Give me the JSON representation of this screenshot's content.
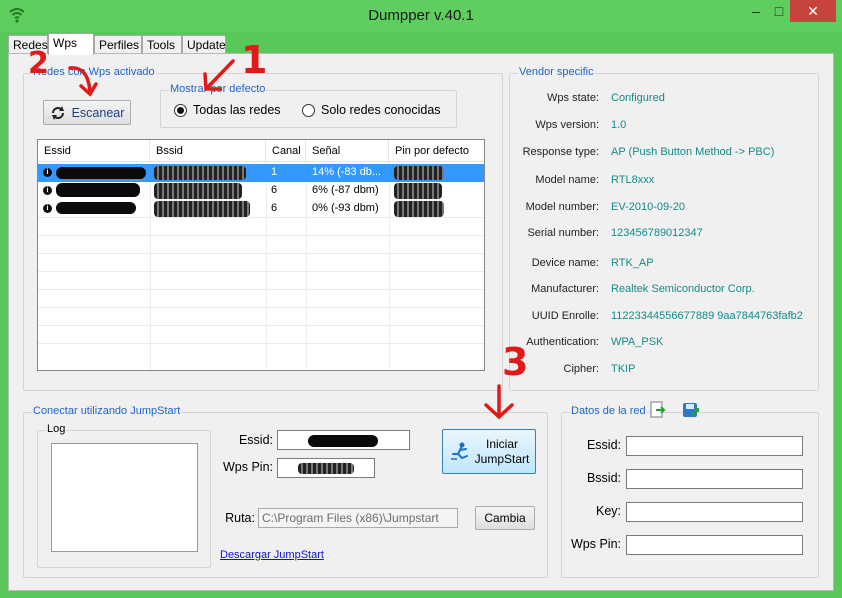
{
  "window": {
    "title": "Dumpper v.40.1"
  },
  "tabs": [
    "Redes",
    "Wps",
    "Perfiles",
    "Tools",
    "Update"
  ],
  "active_tab": "Wps",
  "wps_group": {
    "title": "Redes con Wps activado",
    "scan_button": "Escanear",
    "show_group_title": "Mostrar por defecto",
    "radio_all": "Todas las redes",
    "radio_known": "Solo redes conocidas",
    "selected_radio": "all"
  },
  "table": {
    "columns": [
      "Essid",
      "Bssid",
      "Canal",
      "Señal",
      "Pin por defecto"
    ],
    "rows": [
      {
        "canal": "1",
        "senal": "14% (-83 db...",
        "selected": true
      },
      {
        "canal": "6",
        "senal": "6% (-87 dbm)",
        "selected": false
      },
      {
        "canal": "6",
        "senal": "0% (-93 dbm)",
        "selected": false
      }
    ]
  },
  "vendor": {
    "title": "Vendor specific",
    "fields": [
      {
        "label": "Wps state:",
        "value": "Configured"
      },
      {
        "label": "Wps version:",
        "value": "1.0"
      },
      {
        "label": "Response type:",
        "value": "AP (Push Button Method -> PBC)"
      },
      {
        "label": "Model name:",
        "value": "RTL8xxx"
      },
      {
        "label": "Model number:",
        "value": "EV-2010-09-20"
      },
      {
        "label": "Serial number:",
        "value": "123456789012347"
      },
      {
        "label": "Device name:",
        "value": "RTK_AP"
      },
      {
        "label": "Manufacturer:",
        "value": "Realtek Semiconductor Corp."
      },
      {
        "label": "UUID Enrolle:",
        "value": "11223344556677889 9aa7844763fafb2"
      },
      {
        "label": "Authentication:",
        "value": "WPA_PSK"
      },
      {
        "label": "Cipher:",
        "value": "TKIP"
      }
    ]
  },
  "jumpstart": {
    "title": "Conectar utilizando JumpStart",
    "log_title": "Log",
    "essid_label": "Essid:",
    "wpspin_label": "Wps Pin:",
    "start_button_line1": "Iniciar",
    "start_button_line2": "JumpStart",
    "ruta_label": "Ruta:",
    "ruta_value": "C:\\Program Files (x86)\\Jumpstart",
    "change_button": "Cambia",
    "download_link": "Descargar JumpStart"
  },
  "datos_red": {
    "title": "Datos de la red",
    "essid_label": "Essid:",
    "bssid_label": "Bssid:",
    "key_label": "Key:",
    "wpspin_label": "Wps Pin:"
  },
  "annotations": [
    "1",
    "2",
    "3"
  ],
  "colors": {
    "accent_green": "#59c759",
    "group_title_blue": "#1e64c8",
    "value_teal": "#148a8a",
    "selection_blue": "#3399ff",
    "annotation_red": "#e01a1a"
  },
  "icons": [
    "wifi-app-icon",
    "refresh-icon",
    "jumpstart-icon",
    "export-icon",
    "save-network-icon",
    "info-icon"
  ]
}
